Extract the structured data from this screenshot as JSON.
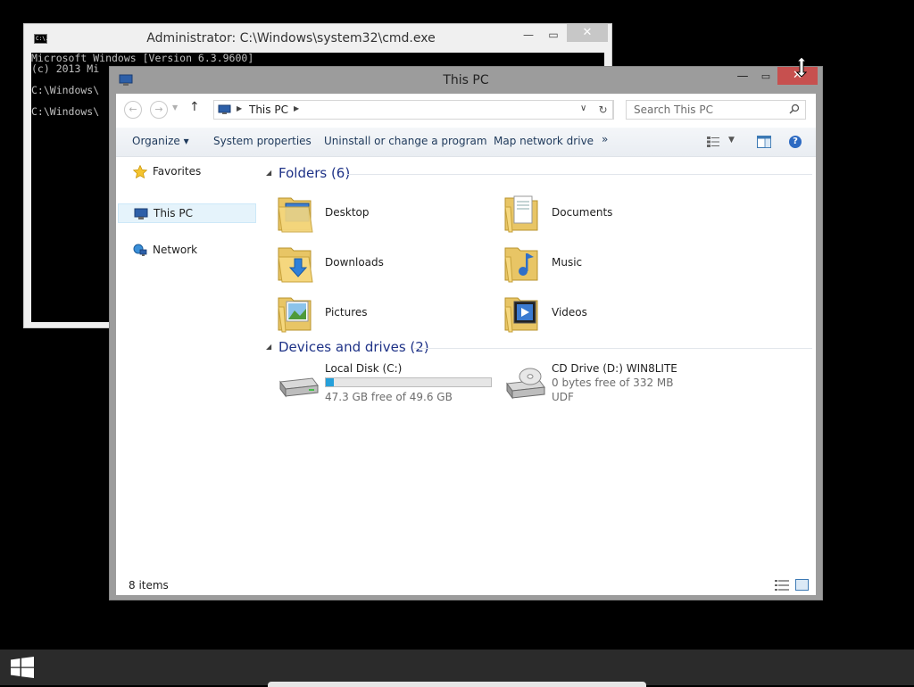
{
  "cmd": {
    "icon_text": "C:\\.",
    "title": "Administrator: C:\\Windows\\system32\\cmd.exe",
    "lines": [
      "Microsoft Windows [Version 6.3.9600]",
      "(c) 2013 Mi",
      "",
      "C:\\Windows\\",
      "",
      "C:\\Windows\\"
    ]
  },
  "explorer": {
    "title": "This PC",
    "address": {
      "location": "This PC"
    },
    "search": {
      "placeholder": "Search This PC"
    },
    "commands": {
      "organize": "Organize",
      "system_properties": "System properties",
      "uninstall": "Uninstall or change a program",
      "map_network_drive": "Map network drive",
      "more": "»"
    },
    "nav": {
      "favorites": "Favorites",
      "this_pc": "This PC",
      "network": "Network"
    },
    "folders": {
      "header": "Folders (6)",
      "items": [
        {
          "label": "Desktop",
          "icon": "desktop-folder-icon"
        },
        {
          "label": "Documents",
          "icon": "documents-folder-icon"
        },
        {
          "label": "Downloads",
          "icon": "downloads-folder-icon"
        },
        {
          "label": "Music",
          "icon": "music-folder-icon"
        },
        {
          "label": "Pictures",
          "icon": "pictures-folder-icon"
        },
        {
          "label": "Videos",
          "icon": "videos-folder-icon"
        }
      ]
    },
    "devices": {
      "header": "Devices and drives (2)",
      "local_disk": {
        "name": "Local Disk (C:)",
        "free": "47.3 GB free of 49.6 GB",
        "used_fraction": 0.046
      },
      "cd_drive": {
        "name": "CD Drive (D:) WIN8LITE",
        "free": "0 bytes free of 332 MB",
        "filesystem": "UDF"
      }
    },
    "status": {
      "item_count": "8 items"
    }
  },
  "colors": {
    "accent_blue": "#26a0da",
    "close_red": "#c7504f",
    "group_header_blue": "#1e3287",
    "taskbar": "#2b2b2b"
  }
}
